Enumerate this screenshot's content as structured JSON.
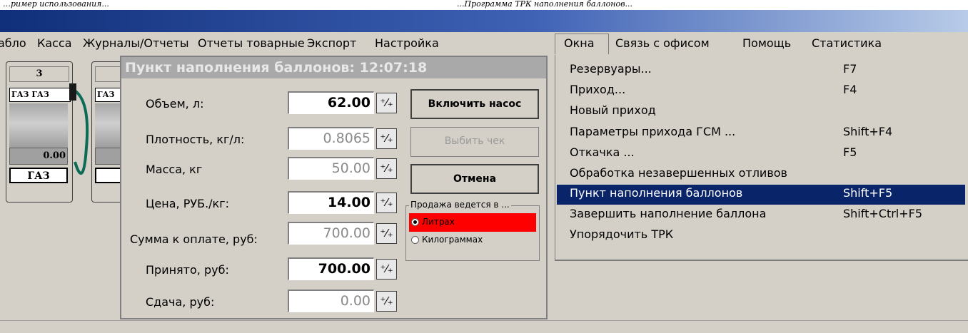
{
  "caption": {
    "left": "…ример использования...",
    "right": "...Программа ТРК наполнения баллонов..."
  },
  "menu": [
    {
      "label": "абло"
    },
    {
      "label": "Касса"
    },
    {
      "label": "Журналы/Отчеты"
    },
    {
      "label": "Отчеты товарные"
    },
    {
      "label": "Экспорт"
    },
    {
      "label": "Настройка"
    },
    {
      "label": "Окна"
    },
    {
      "label": "Связь с офисом"
    },
    {
      "label": "Помощь"
    },
    {
      "label": "Статистика"
    }
  ],
  "pumps": [
    {
      "number": "3",
      "name": "ГАЗ ГАЗ",
      "value": "0.00",
      "fuel": "ГАЗ"
    },
    {
      "number": "",
      "name": "ГАЗ",
      "value": "",
      "fuel": ""
    }
  ],
  "dialog": {
    "title": "Пункт наполнения баллонов: 12:07:18",
    "fields": [
      {
        "label": "Объем, л:",
        "value": "62.00"
      },
      {
        "label": "Плотность, кг/л:",
        "value": "0.8065"
      },
      {
        "label": "Масса, кг",
        "value": "50.00"
      },
      {
        "label": "Цена, РУБ./кг:",
        "value": "14.00"
      },
      {
        "label": "Сумма к оплате, руб:",
        "value": "700.00"
      },
      {
        "label": "Принято, руб:",
        "value": "700.00"
      },
      {
        "label": "Сдача, руб:",
        "value": "0.00"
      }
    ],
    "buttons": {
      "pump_on": "Включить насос",
      "print_receipt": "Выбить чек",
      "cancel": "Отмена"
    },
    "sale_group": {
      "title": "Продажа ведется в ...",
      "options": [
        {
          "label": "Литрах",
          "selected": true
        },
        {
          "label": "Килограммах",
          "selected": false
        }
      ]
    },
    "highlight_color": "#ff0000"
  },
  "windows_menu": [
    {
      "label": "Резервуары...",
      "shortcut": "F7"
    },
    {
      "label": "Приход...",
      "shortcut": "F4"
    },
    {
      "label": "Новый приход",
      "shortcut": ""
    },
    {
      "label": "Параметры прихода ГСМ ...",
      "shortcut": "Shift+F4"
    },
    {
      "label": "Откачка ...",
      "shortcut": "F5"
    },
    {
      "label": "Обработка незавершенных отливов",
      "shortcut": ""
    },
    {
      "label": "Пункт наполнения баллонов",
      "shortcut": "Shift+F5",
      "highlighted": true
    },
    {
      "label": "Завершить наполнение баллона",
      "shortcut": "Shift+Ctrl+F5"
    },
    {
      "label": "Упорядочить ТРК",
      "shortcut": ""
    }
  ],
  "colors": {
    "titlebar": "#102f7a",
    "highlight": "#0a246a"
  }
}
